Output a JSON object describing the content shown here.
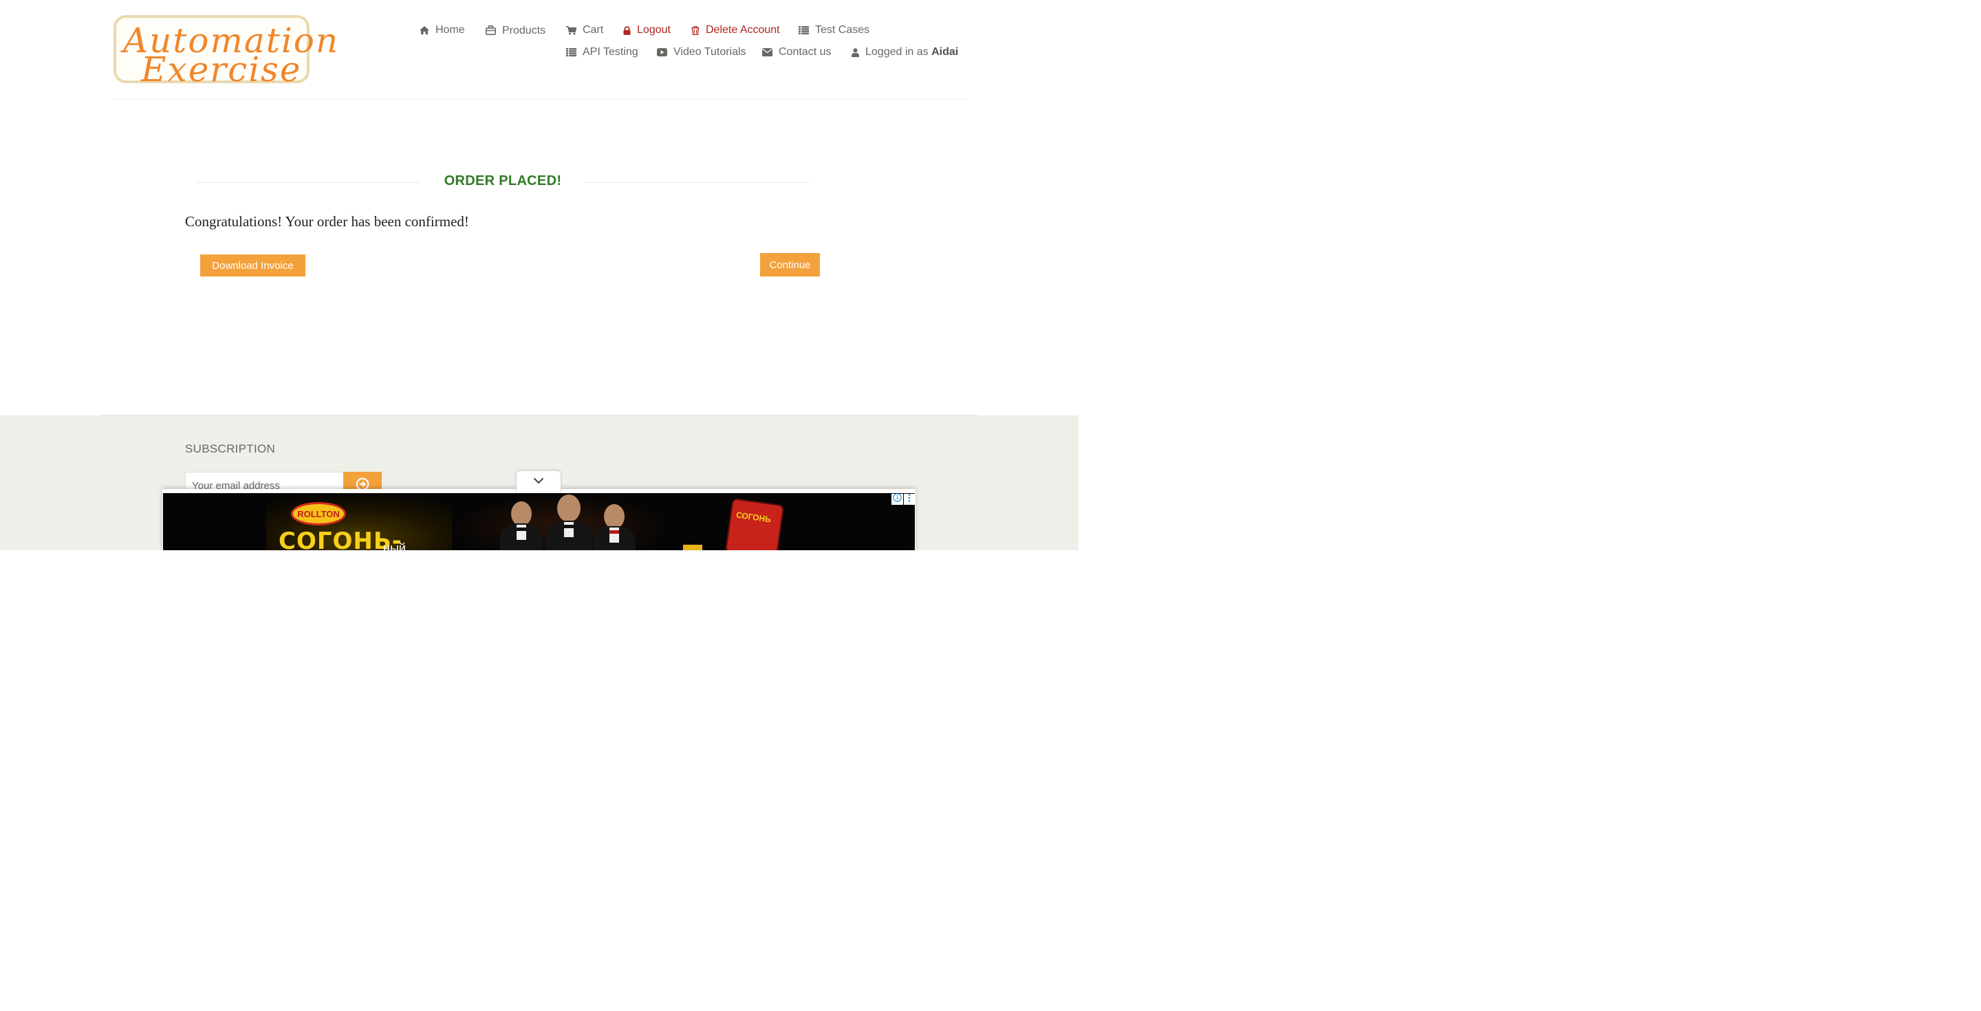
{
  "brand": {
    "logo_line1": "Automation",
    "logo_line2": "Exercise"
  },
  "nav": {
    "home": "Home",
    "products": "Products",
    "cart": "Cart",
    "logout": "Logout",
    "delete_account": "Delete Account",
    "test_cases": "Test Cases",
    "api_testing": "API Testing",
    "video_tutorials": "Video Tutorials",
    "contact_us": "Contact us",
    "logged_in_prefix": "Logged in as",
    "username": "Aidai"
  },
  "main": {
    "title": "ORDER PLACED!",
    "message": "Congratulations! Your order has been confirmed!",
    "download_invoice_label": "Download Invoice",
    "continue_label": "Continue"
  },
  "footer": {
    "subscription_title": "SUBSCRIPTION",
    "email_placeholder": "Your email address"
  },
  "ad": {
    "brand": "ROLLTON",
    "headline": "СОГОНЬ-",
    "subline": "ный",
    "package_label": "СОГОНЬ"
  },
  "colors": {
    "accent_orange": "#f3a13b",
    "success_green": "#317a27",
    "danger_red": "#b02520",
    "footer_bg": "#efefea",
    "text_gray": "#696763"
  },
  "icons": {
    "home": "home-icon",
    "products": "briefcase-icon",
    "cart": "cart-icon",
    "logout": "lock-icon",
    "delete_account": "trash-icon",
    "test_cases": "list-icon",
    "api_testing": "list-icon",
    "video_tutorials": "play-icon",
    "contact_us": "envelope-icon",
    "logged_in": "user-icon",
    "subscribe": "arrow-circle-right-icon",
    "ad_toggle": "chevron-down-icon"
  }
}
